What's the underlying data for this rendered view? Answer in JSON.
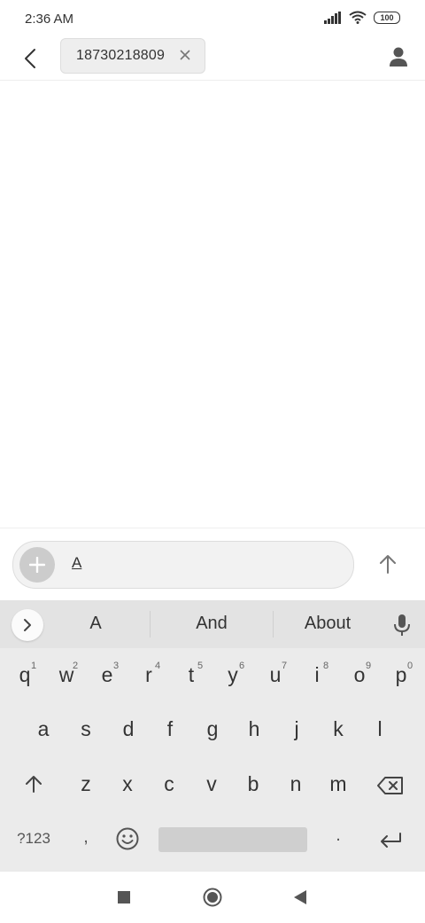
{
  "status_bar": {
    "time": "2:36 AM",
    "battery": "100"
  },
  "header": {
    "recipient": "18730218809"
  },
  "compose": {
    "text": "A"
  },
  "keyboard": {
    "suggestions": [
      "A",
      "And",
      "About"
    ],
    "row1": [
      {
        "k": "q",
        "n": "1"
      },
      {
        "k": "w",
        "n": "2"
      },
      {
        "k": "e",
        "n": "3"
      },
      {
        "k": "r",
        "n": "4"
      },
      {
        "k": "t",
        "n": "5"
      },
      {
        "k": "y",
        "n": "6"
      },
      {
        "k": "u",
        "n": "7"
      },
      {
        "k": "i",
        "n": "8"
      },
      {
        "k": "o",
        "n": "9"
      },
      {
        "k": "p",
        "n": "0"
      }
    ],
    "row2": [
      "a",
      "s",
      "d",
      "f",
      "g",
      "h",
      "j",
      "k",
      "l"
    ],
    "row3": [
      "z",
      "x",
      "c",
      "v",
      "b",
      "n",
      "m"
    ],
    "symbols_label": "?123",
    "comma": ",",
    "period": "."
  },
  "colors": {
    "background": "#ffffff",
    "keyboard": "#ebebeb",
    "suggestion_bar": "#e3e3e3",
    "chip": "#eeeeee",
    "icon": "#333333"
  }
}
